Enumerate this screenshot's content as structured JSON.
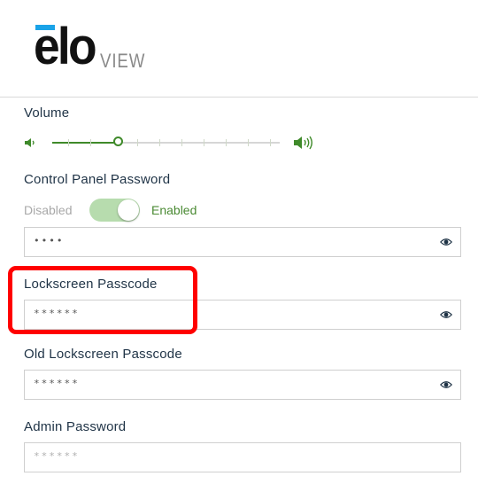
{
  "brand": {
    "logo_text": "elo",
    "product_text": "VIEW"
  },
  "volume": {
    "label": "Volume",
    "level_fraction": 0.3
  },
  "control_panel": {
    "label": "Control Panel Password",
    "toggle_off_label": "Disabled",
    "toggle_on_label": "Enabled",
    "toggle_state": "enabled",
    "value": "••••"
  },
  "lockscreen": {
    "label": "Lockscreen Passcode",
    "value": "******"
  },
  "old_lockscreen": {
    "label": "Old Lockscreen Passcode",
    "value": "******"
  },
  "admin": {
    "label": "Admin Password",
    "placeholder": "******"
  },
  "colors": {
    "accent_green": "#3f8a2a",
    "toggle_green": "#b7dcae",
    "highlight_red": "#ff0000",
    "logo_blue": "#1aa3e8"
  }
}
